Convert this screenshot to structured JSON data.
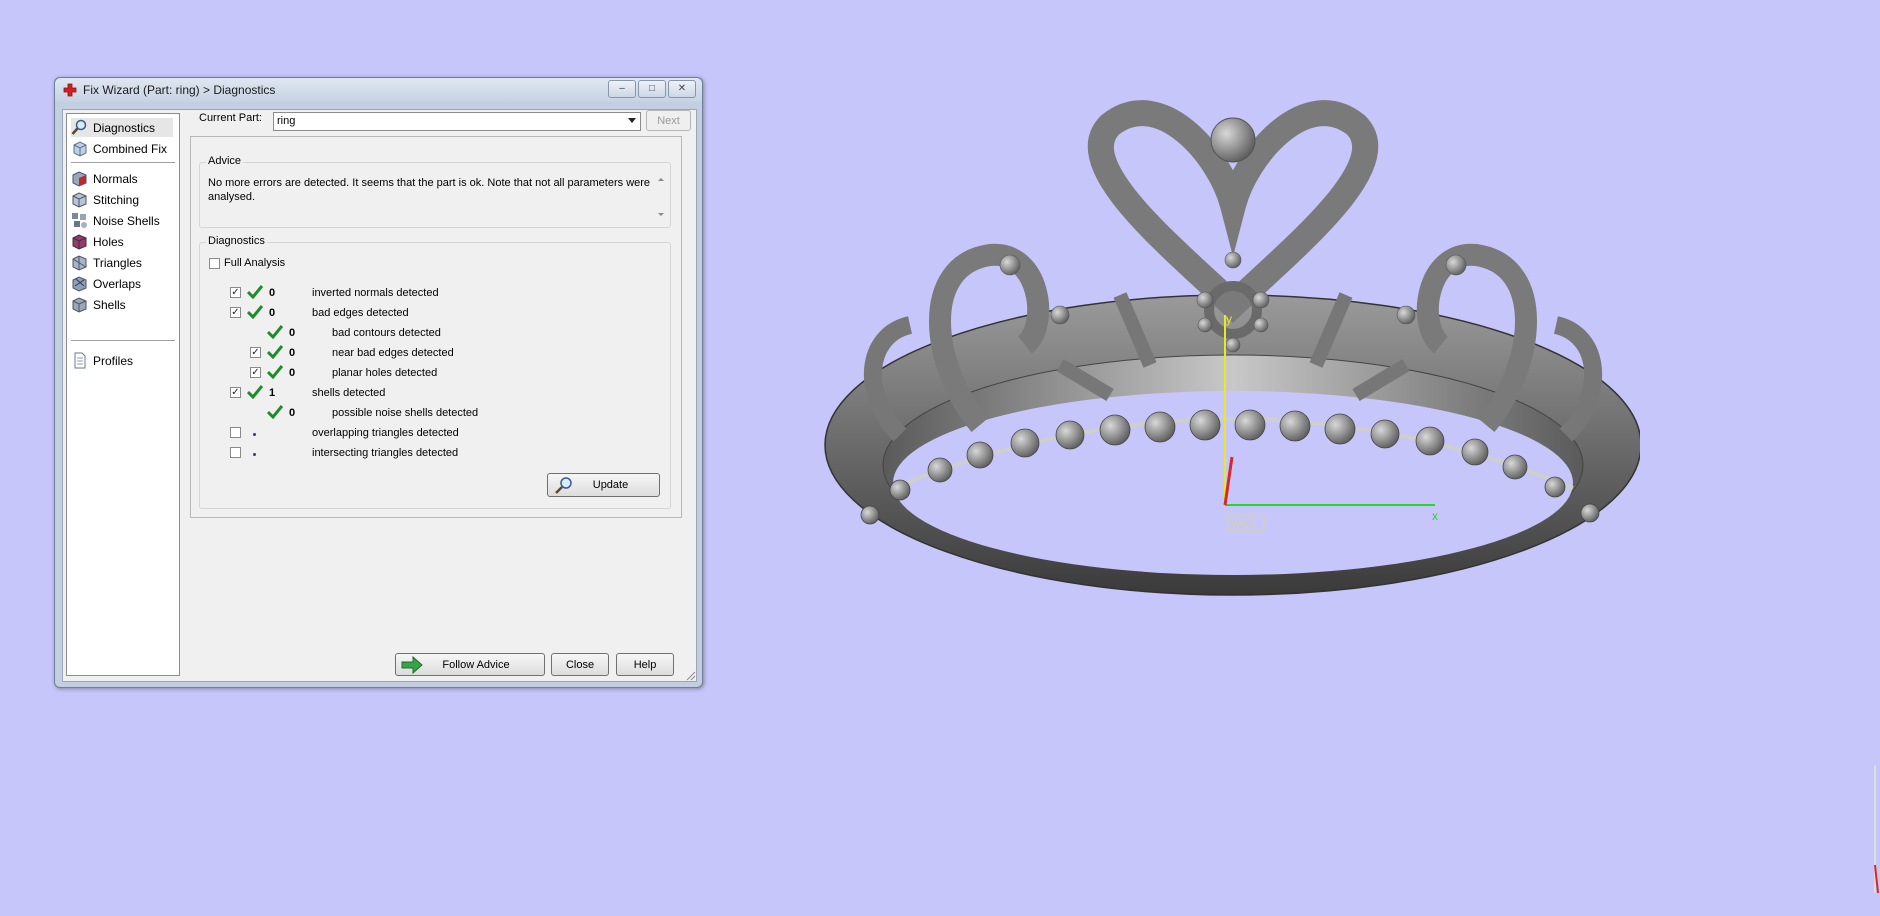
{
  "window": {
    "title": "Fix Wizard (Part: ring) > Diagnostics",
    "controls": [
      "minimize",
      "maximize",
      "close"
    ]
  },
  "sidebar": {
    "items": [
      {
        "label": "Diagnostics",
        "icon": "magnifier-icon",
        "selected": true
      },
      {
        "label": "Combined Fix",
        "icon": "cube-icon"
      },
      {
        "label": "Normals",
        "icon": "normals-cube-icon"
      },
      {
        "label": "Stitching",
        "icon": "stitching-cube-icon"
      },
      {
        "label": "Noise Shells",
        "icon": "noise-shells-icon"
      },
      {
        "label": "Holes",
        "icon": "holes-cube-icon"
      },
      {
        "label": "Triangles",
        "icon": "triangles-cube-icon"
      },
      {
        "label": "Overlaps",
        "icon": "overlaps-cube-icon"
      },
      {
        "label": "Shells",
        "icon": "shells-cube-icon"
      },
      {
        "label": "Profiles",
        "icon": "document-icon"
      }
    ]
  },
  "current_part": {
    "label": "Current Part:",
    "value": "ring",
    "next_label": "Next"
  },
  "advice": {
    "title": "Advice",
    "text": "No more errors are detected. It seems that the part is ok. Note that not all parameters were analysed."
  },
  "diagnostics": {
    "title": "Diagnostics",
    "full_analysis": {
      "label": "Full Analysis",
      "checked": false
    },
    "rows": [
      {
        "checked": true,
        "status": "ok",
        "count": "0",
        "label": "inverted normals detected",
        "indent": 0
      },
      {
        "checked": true,
        "status": "ok",
        "count": "0",
        "label": "bad edges detected",
        "indent": 0
      },
      {
        "checked": null,
        "status": "ok",
        "count": "0",
        "label": "bad contours detected",
        "indent": 1
      },
      {
        "checked": true,
        "status": "ok",
        "count": "0",
        "label": "near bad edges detected",
        "indent": 1
      },
      {
        "checked": true,
        "status": "ok",
        "count": "0",
        "label": "planar holes detected",
        "indent": 1
      },
      {
        "checked": true,
        "status": "ok",
        "count": "1",
        "label": "shells detected",
        "indent": 0
      },
      {
        "checked": null,
        "status": "ok",
        "count": "0",
        "label": "possible noise shells detected",
        "indent": 1
      },
      {
        "checked": false,
        "status": "pending",
        "count": "",
        "label": "overlapping triangles detected",
        "indent": 0
      },
      {
        "checked": false,
        "status": "pending",
        "count": "",
        "label": "intersecting triangles detected",
        "indent": 0
      }
    ],
    "update_label": "Update"
  },
  "footer": {
    "follow_advice": "Follow Advice",
    "close": "Close",
    "help": "Help"
  },
  "viewport": {
    "axis_y": "y",
    "axis_x": "x",
    "wcs_label": "WCS",
    "background": "#c6c6fb"
  }
}
